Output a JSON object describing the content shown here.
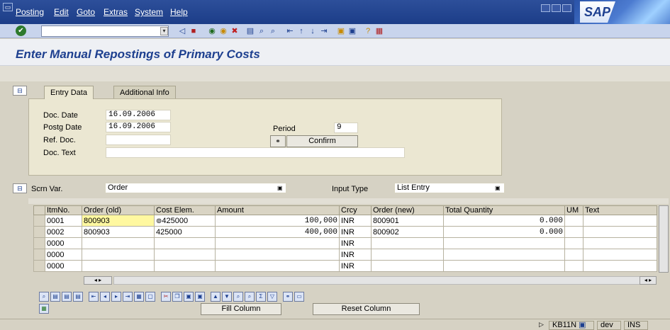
{
  "menu": {
    "items": [
      "Posting",
      "Edit",
      "Goto",
      "Extras",
      "System",
      "Help"
    ]
  },
  "brand": {
    "logo_text": "SAP"
  },
  "page": {
    "title": "Enter Manual Repostings of Primary Costs"
  },
  "tabs": [
    {
      "label": "Entry Data",
      "active": true
    },
    {
      "label": "Additional Info",
      "active": false
    }
  ],
  "entry": {
    "doc_date_label": "Doc. Date",
    "doc_date": "16.09.2006",
    "postg_date_label": "Postg Date",
    "postg_date": "16.09.2006",
    "ref_doc_label": "Ref. Doc.",
    "ref_doc": "",
    "doc_text_label": "Doc. Text",
    "doc_text": "",
    "period_label": "Period",
    "period": "9",
    "confirm_label": "Confirm"
  },
  "screen": {
    "scrn_var_label": "Scrn Var.",
    "scrn_var": "Order",
    "input_type_label": "Input Type",
    "input_type": "List Entry"
  },
  "table": {
    "columns": [
      "ItmNo.",
      "Order (old)",
      "Cost Elem.",
      "Amount",
      "Crcy",
      "Order (new)",
      "Total Quantity",
      "UM",
      "Text"
    ],
    "rows": [
      [
        "0001",
        "800903",
        "425000",
        "100,000",
        "INR",
        "800901",
        "0.000",
        "",
        ""
      ],
      [
        "0002",
        "800903",
        "425000",
        "400,000",
        "INR",
        "800902",
        "0.000",
        "",
        ""
      ],
      [
        "0000",
        "",
        "",
        "",
        "INR",
        "",
        "",
        "",
        ""
      ],
      [
        "0000",
        "",
        "",
        "",
        "INR",
        "",
        "",
        "",
        ""
      ],
      [
        "0000",
        "",
        "",
        "",
        "INR",
        "",
        "",
        "",
        ""
      ]
    ]
  },
  "actions": {
    "fill_column": "Fill Column",
    "reset_column": "Reset Column"
  },
  "status": {
    "tcode": "KB11N",
    "system": "dev",
    "mode": "INS"
  },
  "colors": {
    "menubar": "#2d4f9a",
    "title": "#1d3f8f",
    "panel": "#ebe7d2",
    "highlight": "#fff8a0"
  }
}
